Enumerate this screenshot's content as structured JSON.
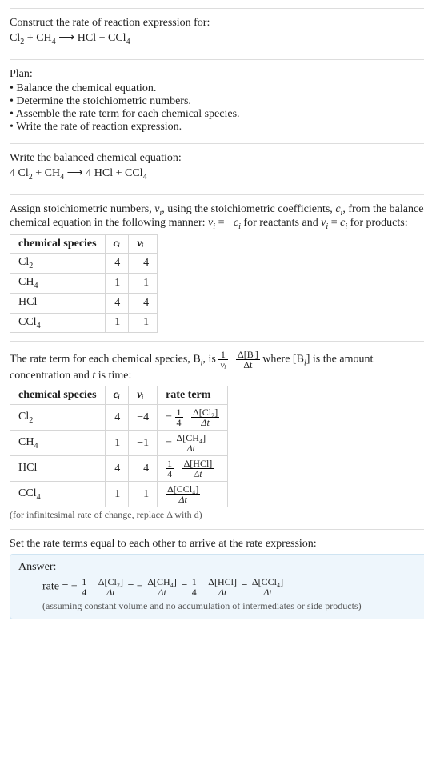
{
  "prompt": {
    "title": "Construct the rate of reaction expression for:",
    "reactants1": "Cl",
    "reactants1_sub": "2",
    "plus": " + ",
    "reactants2": "CH",
    "reactants2_sub": "4",
    "arrow": "  ⟶  ",
    "prod1": "HCl + CCl",
    "prod1_sub": "4"
  },
  "plan": {
    "heading": "Plan:",
    "items": [
      "Balance the chemical equation.",
      "Determine the stoichiometric numbers.",
      "Assemble the rate term for each chemical species.",
      "Write the rate of reaction expression."
    ]
  },
  "balanced": {
    "heading": "Write the balanced chemical equation:",
    "coef1": "4 Cl",
    "sub1": "2",
    "plus1": " + CH",
    "sub2": "4",
    "arrow": "  ⟶  ",
    "coef2": "4 HCl + CCl",
    "sub3": "4"
  },
  "stoich": {
    "pre1": "Assign stoichiometric numbers, ",
    "nu_i": "ν",
    "nu_i_sub": "i",
    "pre2": ", using the stoichiometric coefficients, ",
    "c_i": "c",
    "c_i_sub": "i",
    "pre3": ", from the balanced chemical equation in the following manner: ",
    "eq_r": " = −",
    "pre4": " for reactants and ",
    "eq_p": " = ",
    "pre5": " for products:",
    "headers": {
      "species": "chemical species",
      "c": "cᵢ",
      "nu": "νᵢ"
    },
    "rows": [
      {
        "species": "Cl",
        "species_sub": "2",
        "c": "4",
        "nu": "−4"
      },
      {
        "species": "CH",
        "species_sub": "4",
        "c": "1",
        "nu": "−1"
      },
      {
        "species": "HCl",
        "species_sub": "",
        "c": "4",
        "nu": "4"
      },
      {
        "species": "CCl",
        "species_sub": "4",
        "c": "1",
        "nu": "1"
      }
    ]
  },
  "rateterm": {
    "pre1": "The rate term for each chemical species, B",
    "pre1_sub": "i",
    "pre2": ", is ",
    "coef_num": "1",
    "coef_den": "νᵢ",
    "frac_num": "Δ[Bᵢ]",
    "frac_den": "Δt",
    "pre3": " where [B",
    "pre3_sub": "i",
    "pre4": "] is the amount concentration and ",
    "t": "t",
    "pre5": " is time:",
    "headers": {
      "species": "chemical species",
      "c": "cᵢ",
      "nu": "νᵢ",
      "rate": "rate term"
    },
    "rows": [
      {
        "species": "Cl",
        "species_sub": "2",
        "c": "4",
        "nu": "−4",
        "sign": "−",
        "coef_num": "1",
        "coef_den": "4",
        "num": "Δ[Cl₂]",
        "den": "Δt"
      },
      {
        "species": "CH",
        "species_sub": "4",
        "c": "1",
        "nu": "−1",
        "sign": "−",
        "coef_num": "",
        "coef_den": "",
        "num": "Δ[CH₄]",
        "den": "Δt"
      },
      {
        "species": "HCl",
        "species_sub": "",
        "c": "4",
        "nu": "4",
        "sign": "",
        "coef_num": "1",
        "coef_den": "4",
        "num": "Δ[HCl]",
        "den": "Δt"
      },
      {
        "species": "CCl",
        "species_sub": "4",
        "c": "1",
        "nu": "1",
        "sign": "",
        "coef_num": "",
        "coef_den": "",
        "num": "Δ[CCl₄]",
        "den": "Δt"
      }
    ],
    "note": "(for infinitesimal rate of change, replace Δ with d)"
  },
  "final": {
    "heading": "Set the rate terms equal to each other to arrive at the rate expression:",
    "label": "Answer:",
    "rate": "rate = ",
    "t1_sign": "−",
    "t1_cnum": "1",
    "t1_cden": "4",
    "t1_num": "Δ[Cl₂]",
    "t1_den": "Δt",
    "eq": " = ",
    "t2_sign": "−",
    "t2_cnum": "",
    "t2_cden": "",
    "t2_num": "Δ[CH₄]",
    "t2_den": "Δt",
    "t3_sign": "",
    "t3_cnum": "1",
    "t3_cden": "4",
    "t3_num": "Δ[HCl]",
    "t3_den": "Δt",
    "t4_sign": "",
    "t4_cnum": "",
    "t4_cden": "",
    "t4_num": "Δ[CCl₄]",
    "t4_den": "Δt",
    "note": "(assuming constant volume and no accumulation of intermediates or side products)"
  }
}
